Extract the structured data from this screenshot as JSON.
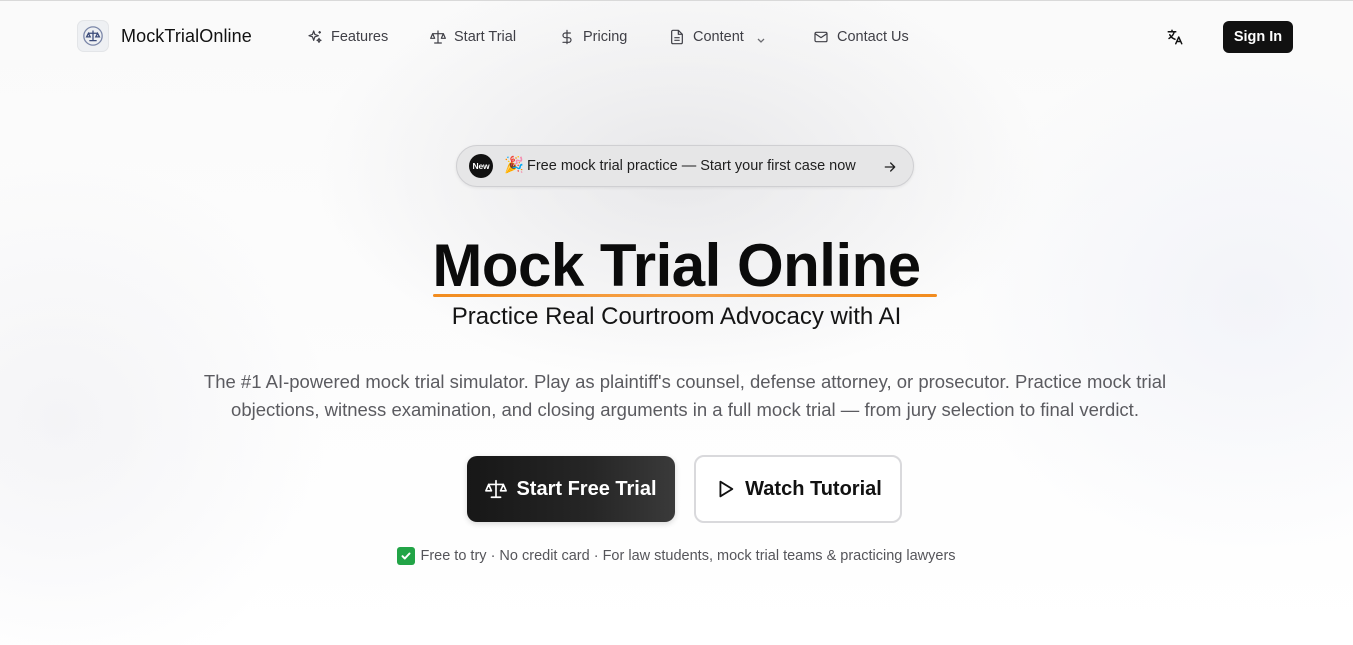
{
  "nav": {
    "brand": "MockTrialOnline",
    "items": [
      {
        "label": "Features",
        "icon": "sparkles-icon"
      },
      {
        "label": "Start Trial",
        "icon": "scale-icon"
      },
      {
        "label": "Pricing",
        "icon": "dollar-icon"
      },
      {
        "label": "Content",
        "icon": "document-icon"
      },
      {
        "label": "Contact Us",
        "icon": "mail-icon"
      }
    ],
    "language_icon": "translate-icon",
    "signin": "Sign In"
  },
  "hero": {
    "badge": {
      "pill": "New",
      "emoji": "🎉",
      "text": "Free mock trial practice — Start your first case now"
    },
    "title": "Mock Trial Online",
    "subtitle": "Practice Real Courtroom Advocacy with AI",
    "description": "The #1 AI-powered mock trial simulator. Play as plaintiff's counsel, defense attorney, or prosecutor. Practice mock trial objections, witness examination, and closing arguments in a full mock trial — from jury selection to final verdict.",
    "primary_cta": "Start Free Trial",
    "secondary_cta": "Watch Tutorial",
    "note": "Free to try · No credit card · For law students, mock trial teams & practicing lawyers"
  },
  "colors": {
    "accent_underline": "#f28c1e",
    "primary_button": "#171717",
    "check": "#22a447"
  }
}
